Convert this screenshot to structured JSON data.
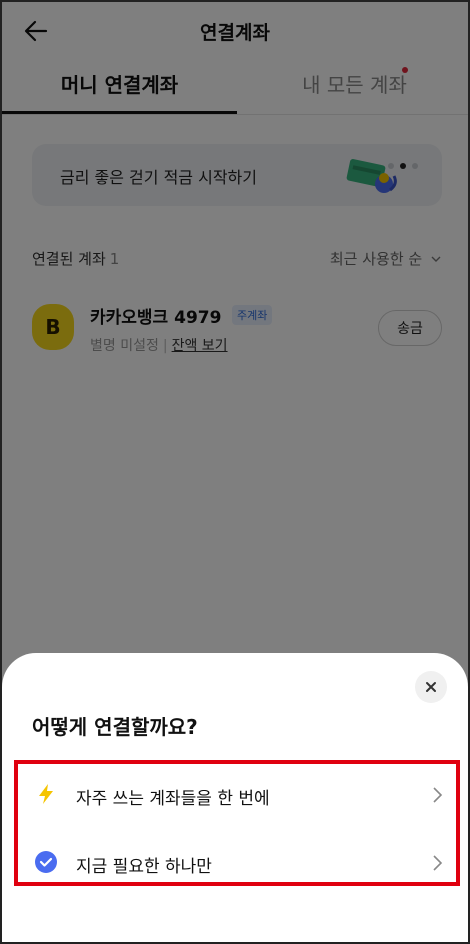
{
  "header": {
    "title": "연결계좌"
  },
  "tabs": [
    {
      "label": "머니 연결계좌",
      "active": true
    },
    {
      "label": "내 모든 계좌",
      "active": false,
      "has_new_dot": true
    }
  ],
  "banner": {
    "text": "금리 좋은 걷기 적금 시작하기",
    "pager": {
      "count": 3,
      "current": 2
    }
  },
  "linked_accounts": {
    "title": "연결된 계좌",
    "count": "1",
    "sort_label": "최근 사용한 순",
    "items": [
      {
        "bank_logo_letter": "B",
        "name": "카카오뱅크 4979",
        "badge": "주계좌",
        "nickname": "별명 미설정",
        "separator": "|",
        "balance_link": "잔액 보기",
        "send_label": "송금"
      }
    ]
  },
  "sheet": {
    "title": "어떻게 연결할까요?",
    "options": [
      {
        "icon": "lightning-icon",
        "label": "자주 쓰는 계좌들을 한 번에"
      },
      {
        "icon": "check-circle-icon",
        "label": "지금 필요한 하나만"
      }
    ]
  },
  "colors": {
    "kakao_yellow": "#F7D81C",
    "highlight_red": "#E0000F",
    "check_blue": "#4A6CF0",
    "lightning_yellow": "#F5C400"
  }
}
